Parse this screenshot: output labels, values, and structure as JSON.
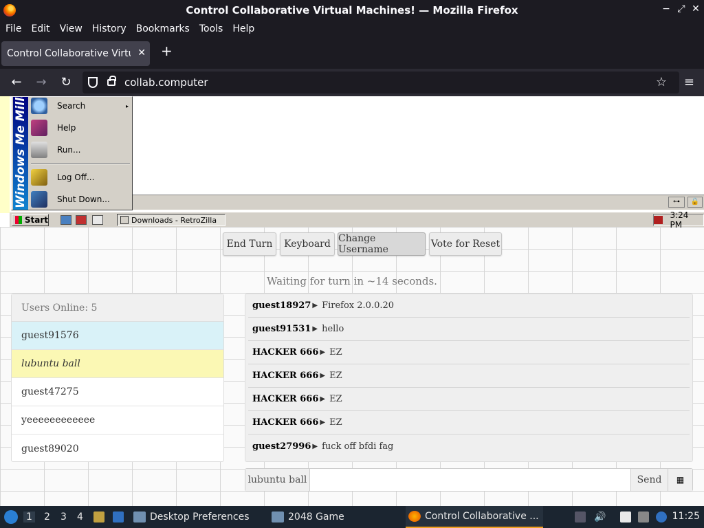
{
  "window": {
    "title": "Control Collaborative Virtual Machines! — Mozilla Firefox",
    "controls": {
      "minimize": "−",
      "maximize": "⤢",
      "close": "✕"
    }
  },
  "menubar": [
    "File",
    "Edit",
    "View",
    "History",
    "Bookmarks",
    "Tools",
    "Help"
  ],
  "tabs": [
    {
      "title": "Control Collaborative Virtual Machines!",
      "close": "✕"
    }
  ],
  "newtab": "+",
  "nav": {
    "back": "←",
    "forward": "→",
    "reload": "↻",
    "url": "collab.computer",
    "star": "☆",
    "menu": "≡"
  },
  "vm": {
    "start_menu": {
      "banner": "Windows Me Millennium",
      "items": [
        {
          "label": "Search",
          "icon": "search-icon",
          "submenu": "▸"
        },
        {
          "label": "Help",
          "icon": "help-book-icon"
        },
        {
          "label": "Run...",
          "icon": "run-icon"
        },
        {
          "label": "Log Off...",
          "icon": "key-icon"
        },
        {
          "label": "Shut Down...",
          "icon": "shutdown-icon"
        }
      ]
    },
    "taskbar": {
      "start_label": "Start",
      "task": "Downloads - RetroZilla",
      "clock": "3:24 PM"
    }
  },
  "controls": {
    "buttons": [
      "End Turn",
      "Keyboard",
      "Change Username",
      "Vote for Reset"
    ],
    "waiting": "Waiting for turn in ~14 seconds."
  },
  "users": {
    "header": "Users Online: 5",
    "list": [
      "guest91576",
      "lubuntu ball",
      "guest47275",
      "yeeeeeeeeeeee",
      "guest89020"
    ]
  },
  "chat": [
    {
      "user": "guest18927",
      "message": "Firefox 2.0.0.20"
    },
    {
      "user": "guest91531",
      "message": "hello"
    },
    {
      "user": "HACKER 666",
      "message": "EZ"
    },
    {
      "user": "HACKER 666",
      "message": "EZ"
    },
    {
      "user": "HACKER 666",
      "message": "EZ"
    },
    {
      "user": "HACKER 666",
      "message": "EZ"
    },
    {
      "user": "guest27996",
      "message": "fuck off bfdi fag"
    }
  ],
  "chat_separator": "▶",
  "input": {
    "username": "lubuntu ball",
    "value": "",
    "send": "Send",
    "keyboard_icon": "▦"
  },
  "panel": {
    "workspaces": [
      "1",
      "2",
      "3",
      "4"
    ],
    "tasks": [
      "Desktop Preferences",
      "2048 Game",
      "Control Collaborative ..."
    ],
    "clock": "11:25"
  },
  "colors": {
    "firefox_dark": "#1c1b22",
    "self_row": "#d9f2f8",
    "turn_row": "#fbf8b4",
    "panel_bg": "#1b2530"
  }
}
